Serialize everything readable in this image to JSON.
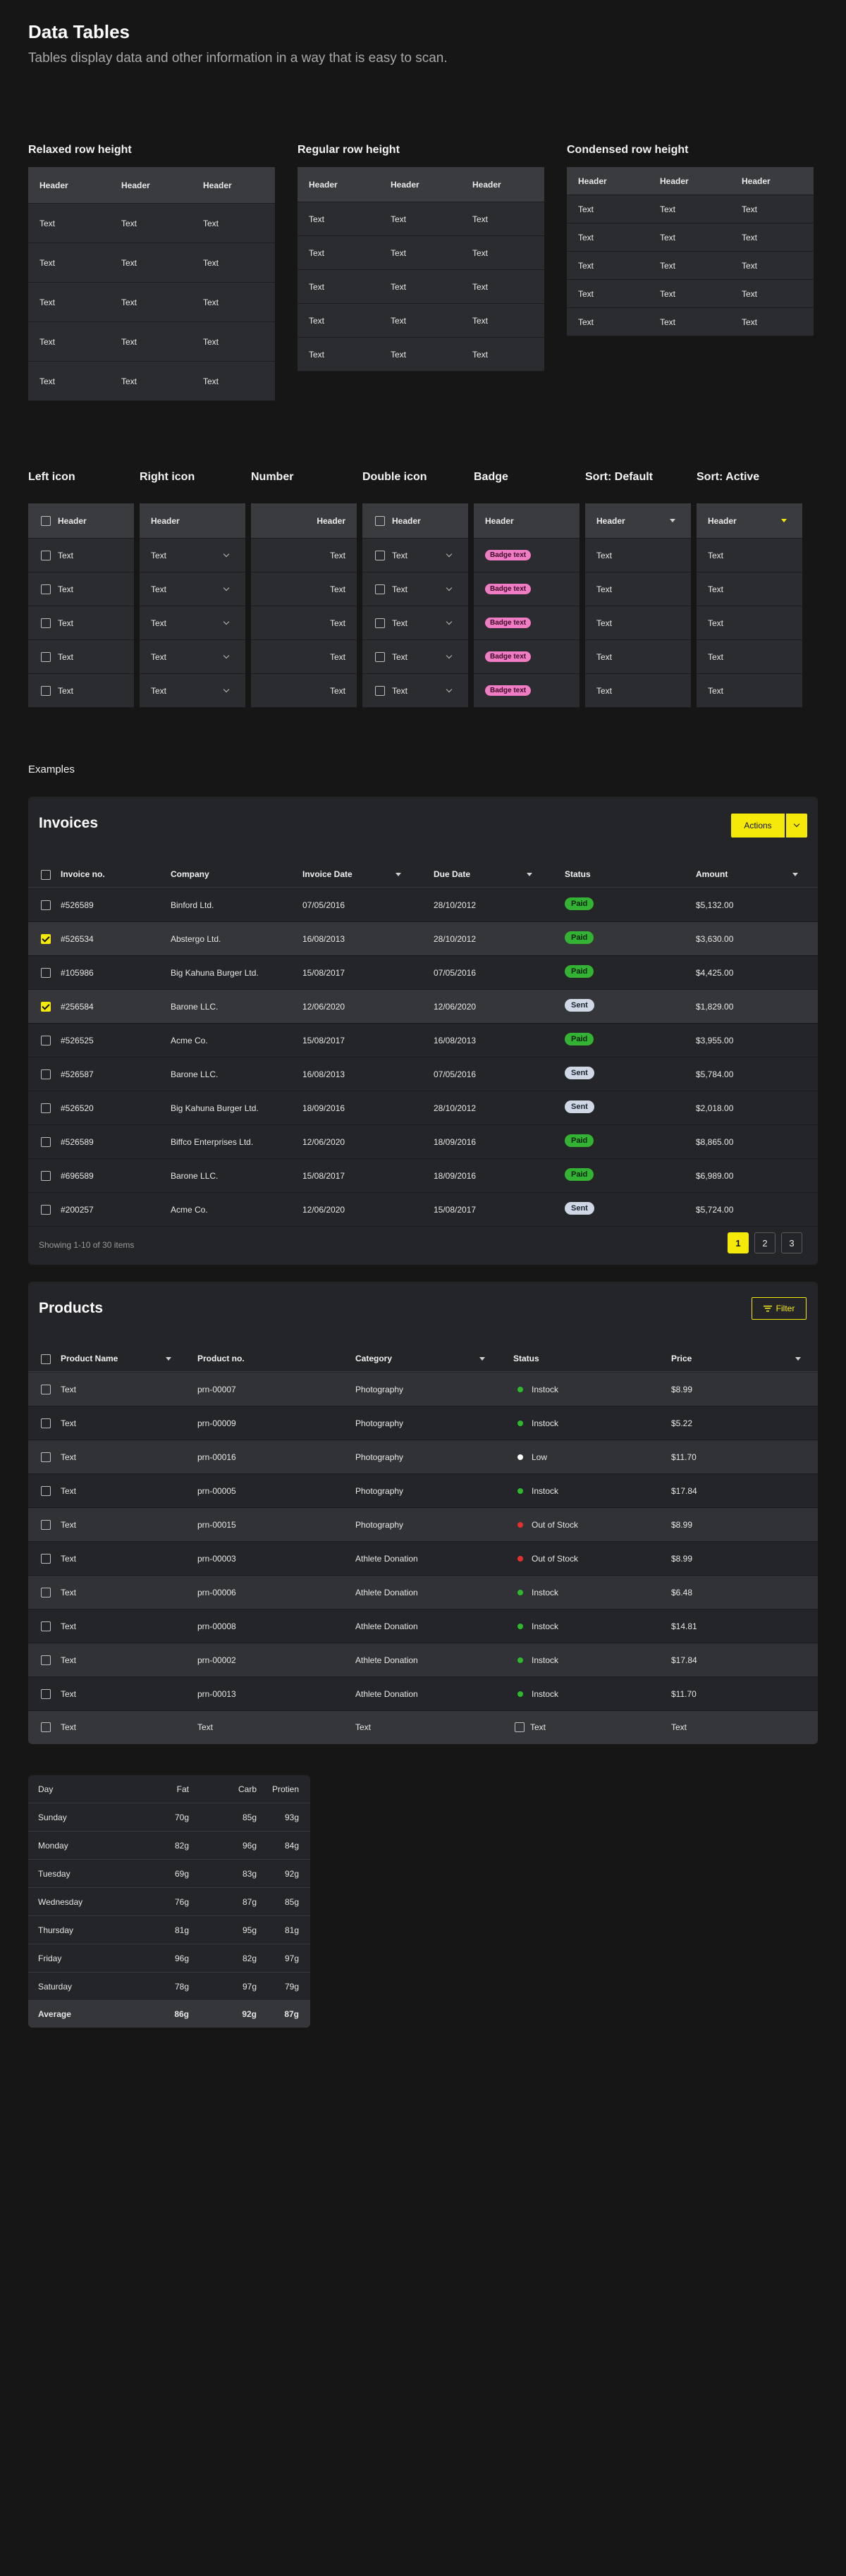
{
  "title": "Data Tables",
  "subtitle": "Tables display data and other information in a way that is easy to scan.",
  "row_heights": [
    {
      "label": "Relaxed row height",
      "headers": [
        "Header",
        "Header",
        "Header"
      ],
      "rows": [
        [
          "Text",
          "Text",
          "Text"
        ],
        [
          "Text",
          "Text",
          "Text"
        ],
        [
          "Text",
          "Text",
          "Text"
        ],
        [
          "Text",
          "Text",
          "Text"
        ],
        [
          "Text",
          "Text",
          "Text"
        ]
      ]
    },
    {
      "label": "Regular row height",
      "headers": [
        "Header",
        "Header",
        "Header"
      ],
      "rows": [
        [
          "Text",
          "Text",
          "Text"
        ],
        [
          "Text",
          "Text",
          "Text"
        ],
        [
          "Text",
          "Text",
          "Text"
        ],
        [
          "Text",
          "Text",
          "Text"
        ],
        [
          "Text",
          "Text",
          "Text"
        ]
      ]
    },
    {
      "label": "Condensed row height",
      "headers": [
        "Header",
        "Header",
        "Header"
      ],
      "rows": [
        [
          "Text",
          "Text",
          "Text"
        ],
        [
          "Text",
          "Text",
          "Text"
        ],
        [
          "Text",
          "Text",
          "Text"
        ],
        [
          "Text",
          "Text",
          "Text"
        ],
        [
          "Text",
          "Text",
          "Text"
        ]
      ]
    }
  ],
  "variants": [
    {
      "label": "Left icon",
      "header": "Header",
      "cells": [
        "Text",
        "Text",
        "Text",
        "Text",
        "Text"
      ]
    },
    {
      "label": "Right icon",
      "header": "Header",
      "cells": [
        "Text",
        "Text",
        "Text",
        "Text",
        "Text"
      ]
    },
    {
      "label": "Number",
      "header": "Header",
      "cells": [
        "Text",
        "Text",
        "Text",
        "Text",
        "Text"
      ]
    },
    {
      "label": "Double icon",
      "header": "Header",
      "cells": [
        "Text",
        "Text",
        "Text",
        "Text",
        "Text"
      ]
    },
    {
      "label": "Badge",
      "header": "Header",
      "cells": [
        "Badge text",
        "Badge text",
        "Badge text",
        "Badge text",
        "Badge text"
      ]
    },
    {
      "label": "Sort: Default",
      "header": "Header",
      "cells": [
        "Text",
        "Text",
        "Text",
        "Text",
        "Text"
      ]
    },
    {
      "label": "Sort: Active",
      "header": "Header",
      "cells": [
        "Text",
        "Text",
        "Text",
        "Text",
        "Text"
      ]
    }
  ],
  "examples_label": "Examples",
  "invoices": {
    "title": "Invoices",
    "actions_label": "Actions",
    "columns": [
      "Invoice no.",
      "Company",
      "Invoice Date",
      "Due Date",
      "Status",
      "Amount"
    ],
    "rows": [
      {
        "no": "#526589",
        "company": "Binford Ltd.",
        "inv": "07/05/2016",
        "due": "28/10/2012",
        "status": "Paid",
        "amount": "$5,132.00",
        "checked": false
      },
      {
        "no": "#526534",
        "company": "Abstergo Ltd.",
        "inv": "16/08/2013",
        "due": "28/10/2012",
        "status": "Paid",
        "amount": "$3,630.00",
        "checked": true
      },
      {
        "no": "#105986",
        "company": "Big Kahuna Burger Ltd.",
        "inv": "15/08/2017",
        "due": "07/05/2016",
        "status": "Paid",
        "amount": "$4,425.00",
        "checked": false
      },
      {
        "no": "#256584",
        "company": "Barone LLC.",
        "inv": "12/06/2020",
        "due": "12/06/2020",
        "status": "Sent",
        "amount": "$1,829.00",
        "checked": true
      },
      {
        "no": "#526525",
        "company": "Acme Co.",
        "inv": "15/08/2017",
        "due": "16/08/2013",
        "status": "Paid",
        "amount": "$3,955.00",
        "checked": false
      },
      {
        "no": "#526587",
        "company": "Barone LLC.",
        "inv": "16/08/2013",
        "due": "07/05/2016",
        "status": "Sent",
        "amount": "$5,784.00",
        "checked": false
      },
      {
        "no": "#526520",
        "company": "Big Kahuna Burger Ltd.",
        "inv": "18/09/2016",
        "due": "28/10/2012",
        "status": "Sent",
        "amount": "$2,018.00",
        "checked": false
      },
      {
        "no": "#526589",
        "company": "Biffco Enterprises Ltd.",
        "inv": "12/06/2020",
        "due": "18/09/2016",
        "status": "Paid",
        "amount": "$8,865.00",
        "checked": false
      },
      {
        "no": "#696589",
        "company": "Barone LLC.",
        "inv": "15/08/2017",
        "due": "18/09/2016",
        "status": "Paid",
        "amount": "$6,989.00",
        "checked": false
      },
      {
        "no": "#200257",
        "company": "Acme Co.",
        "inv": "12/06/2020",
        "due": "15/08/2017",
        "status": "Sent",
        "amount": "$5,724.00",
        "checked": false
      }
    ],
    "footer_text": "Showing 1-10 of 30 items",
    "pages": [
      "1",
      "2",
      "3"
    ]
  },
  "products": {
    "title": "Products",
    "filter_label": "Filter",
    "columns": [
      "Product Name",
      "Product no.",
      "Category",
      "Status",
      "Price"
    ],
    "rows": [
      {
        "name": "Text",
        "no": "prn-00007",
        "cat": "Photography",
        "status": "Instock",
        "dot": "#2fb82c",
        "price": "$8.99"
      },
      {
        "name": "Text",
        "no": "prn-00009",
        "cat": "Photography",
        "status": "Instock",
        "dot": "#2fb82c",
        "price": "$5.22"
      },
      {
        "name": "Text",
        "no": "prn-00016",
        "cat": "Photography",
        "status": "Low",
        "dot": "#ffffff",
        "price": "$11.70"
      },
      {
        "name": "Text",
        "no": "prn-00005",
        "cat": "Photography",
        "status": "Instock",
        "dot": "#2fb82c",
        "price": "$17.84"
      },
      {
        "name": "Text",
        "no": "prn-00015",
        "cat": "Photography",
        "status": "Out of Stock",
        "dot": "#e0312f",
        "price": "$8.99"
      },
      {
        "name": "Text",
        "no": "prn-00003",
        "cat": "Athlete Donation",
        "status": "Out of Stock",
        "dot": "#e0312f",
        "price": "$8.99"
      },
      {
        "name": "Text",
        "no": "prn-00006",
        "cat": "Athlete Donation",
        "status": "Instock",
        "dot": "#2fb82c",
        "price": "$6.48"
      },
      {
        "name": "Text",
        "no": "prn-00008",
        "cat": "Athlete Donation",
        "status": "Instock",
        "dot": "#2fb82c",
        "price": "$14.81"
      },
      {
        "name": "Text",
        "no": "prn-00002",
        "cat": "Athlete Donation",
        "status": "Instock",
        "dot": "#2fb82c",
        "price": "$17.84"
      },
      {
        "name": "Text",
        "no": "prn-00013",
        "cat": "Athlete Donation",
        "status": "Instock",
        "dot": "#2fb82c",
        "price": "$11.70"
      }
    ],
    "footer": [
      "Text",
      "Text",
      "Text",
      "Text",
      "Text"
    ]
  },
  "nutrition": {
    "columns": [
      "Day",
      "Fat",
      "Carb",
      "Protien"
    ],
    "rows": [
      [
        "Sunday",
        "70g",
        "85g",
        "93g"
      ],
      [
        "Monday",
        "82g",
        "96g",
        "84g"
      ],
      [
        "Tuesday",
        "69g",
        "83g",
        "92g"
      ],
      [
        "Wednesday",
        "76g",
        "87g",
        "85g"
      ],
      [
        "Thursday",
        "81g",
        "95g",
        "81g"
      ],
      [
        "Friday",
        "96g",
        "82g",
        "97g"
      ],
      [
        "Saturday",
        "78g",
        "97g",
        "79g"
      ]
    ],
    "average": [
      "Average",
      "86g",
      "92g",
      "87g"
    ]
  }
}
